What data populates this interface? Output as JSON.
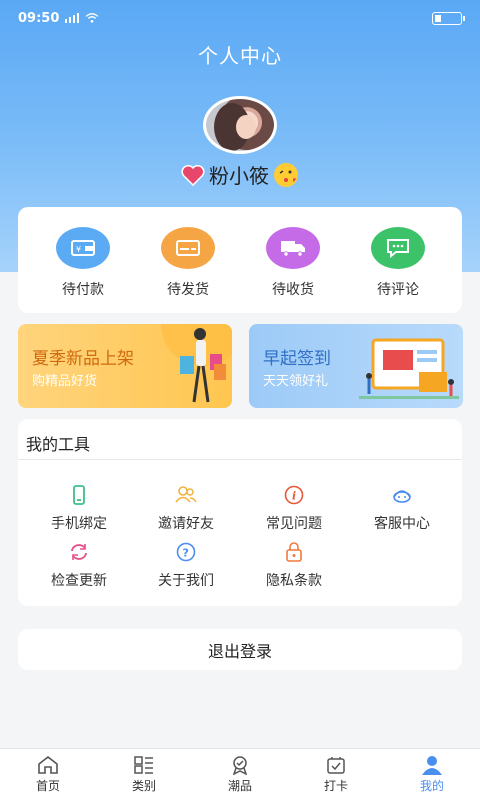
{
  "status_bar": {
    "time": "09:50"
  },
  "header": {
    "title": "个人中心"
  },
  "profile": {
    "name": "粉小筱"
  },
  "orders": [
    {
      "label": "待付款",
      "color": "#5aaaf4"
    },
    {
      "label": "待发货",
      "color": "#f6a545"
    },
    {
      "label": "待收货",
      "color": "#c56be8"
    },
    {
      "label": "待评论",
      "color": "#3cc36a"
    }
  ],
  "banners": {
    "left": {
      "title": "夏季新品上架",
      "subtitle": "购精品好货",
      "title_color": "#d06a10"
    },
    "right": {
      "title": "早起签到",
      "subtitle": "天天领好礼",
      "title_color": "#2f6fc6"
    }
  },
  "tools": {
    "title": "我的工具",
    "items": [
      {
        "label": "手机绑定",
        "icon": "phone-icon",
        "color": "#3cbf8a"
      },
      {
        "label": "邀请好友",
        "icon": "friends-icon",
        "color": "#f2b23a"
      },
      {
        "label": "常见问题",
        "icon": "info-icon",
        "color": "#e8583b"
      },
      {
        "label": "客服中心",
        "icon": "service-icon",
        "color": "#4a8ef0"
      },
      {
        "label": "检查更新",
        "icon": "refresh-icon",
        "color": "#e8508a"
      },
      {
        "label": "关于我们",
        "icon": "question-icon",
        "color": "#4a8ef0"
      },
      {
        "label": "隐私条款",
        "icon": "lock-icon",
        "color": "#f2793a"
      }
    ]
  },
  "logout": {
    "label": "退出登录"
  },
  "tabbar": [
    {
      "label": "首页",
      "icon": "home-icon"
    },
    {
      "label": "类别",
      "icon": "category-icon"
    },
    {
      "label": "潮品",
      "icon": "trend-icon"
    },
    {
      "label": "打卡",
      "icon": "checkin-icon"
    },
    {
      "label": "我的",
      "icon": "profile-icon",
      "active": true
    }
  ]
}
